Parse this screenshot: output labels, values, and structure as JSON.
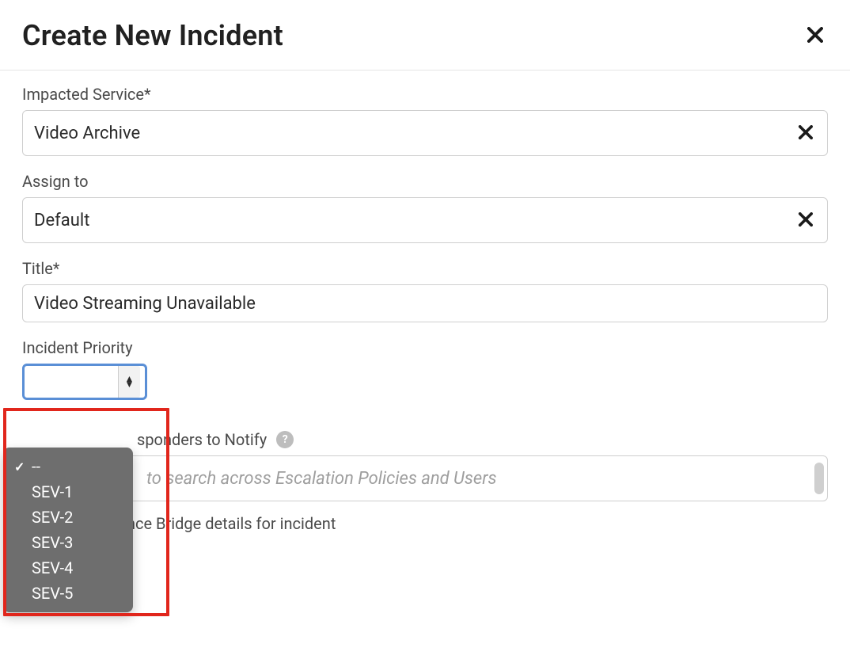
{
  "header": {
    "title": "Create New Incident",
    "close_icon": "close"
  },
  "fields": {
    "impacted_service": {
      "label": "Impacted Service*",
      "value": "Video Archive"
    },
    "assign_to": {
      "label": "Assign to",
      "value": "Default"
    },
    "title": {
      "label": "Title*",
      "value": "Video Streaming Unavailable"
    },
    "priority": {
      "label": "Incident Priority",
      "selected": "--",
      "options": [
        "--",
        "SEV-1",
        "SEV-2",
        "SEV-3",
        "SEV-4",
        "SEV-5"
      ]
    },
    "responders": {
      "label_partial": "sponders to Notify",
      "placeholder": "to search across Escalation Policies and Users"
    },
    "conference_bridge": {
      "label": "Set Conference Bridge details for incident",
      "checked": false
    }
  }
}
